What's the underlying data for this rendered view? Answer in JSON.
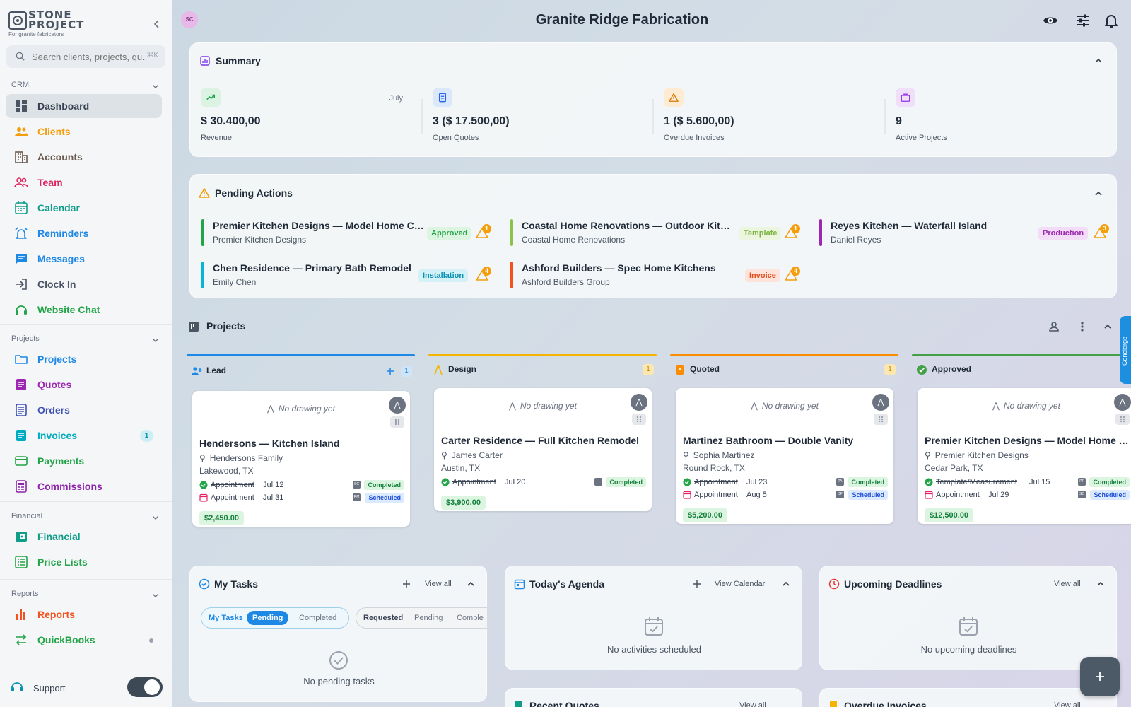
{
  "brand": {
    "line1": "STONE",
    "line2": "PROJECT",
    "tagline": "For granite fabricators"
  },
  "search": {
    "placeholder": "Search clients, projects, qu…",
    "shortcut": "⌘K"
  },
  "sidebar": {
    "sections": [
      {
        "label": "CRM",
        "items": [
          {
            "label": "Dashboard",
            "icon": "dashboard-icon",
            "color": "#4b5563",
            "active": true
          },
          {
            "label": "Clients",
            "icon": "people-icon",
            "color": "#f59e0b"
          },
          {
            "label": "Accounts",
            "icon": "building-icon",
            "color": "#6b5a4e"
          },
          {
            "label": "Team",
            "icon": "team-icon",
            "color": "#e0245e"
          },
          {
            "label": "Calendar",
            "icon": "calendar-icon",
            "color": "#0f9d8a"
          },
          {
            "label": "Reminders",
            "icon": "alarm-icon",
            "color": "#1e88e5"
          },
          {
            "label": "Messages",
            "icon": "message-icon",
            "color": "#1e88e5"
          },
          {
            "label": "Clock In",
            "icon": "login-icon",
            "color": "#4b5563"
          },
          {
            "label": "Website Chat",
            "icon": "headset-icon",
            "color": "#22a447"
          }
        ]
      },
      {
        "label": "Projects",
        "items": [
          {
            "label": "Projects",
            "icon": "folder-icon",
            "color": "#1e88e5"
          },
          {
            "label": "Quotes",
            "icon": "quote-icon",
            "color": "#9c27b0"
          },
          {
            "label": "Orders",
            "icon": "orders-icon",
            "color": "#3f51b5"
          },
          {
            "label": "Invoices",
            "icon": "invoice-icon",
            "color": "#00acc1",
            "badge": "1"
          },
          {
            "label": "Payments",
            "icon": "card-icon",
            "color": "#22a447"
          },
          {
            "label": "Commissions",
            "icon": "commission-icon",
            "color": "#8e24aa"
          }
        ]
      },
      {
        "label": "Financial",
        "items": [
          {
            "label": "Financial",
            "icon": "financial-icon",
            "color": "#0f9d8a"
          },
          {
            "label": "Price Lists",
            "icon": "pricelist-icon",
            "color": "#22a447"
          }
        ]
      },
      {
        "label": "Reports",
        "items": [
          {
            "label": "Reports",
            "icon": "barchart-icon",
            "color": "#f4511e"
          },
          {
            "label": "QuickBooks",
            "icon": "sync-icon",
            "color": "#22a447",
            "dot": true
          }
        ]
      }
    ],
    "support_label": "Support"
  },
  "header": {
    "avatar": "SC",
    "title": "Granite Ridge Fabrication"
  },
  "summary": {
    "title": "Summary",
    "metrics": [
      {
        "value": "$ 30.400,00",
        "label": "Revenue",
        "meta": "July",
        "icon": "trending-up-icon",
        "color": "#16a34a",
        "bg": "#dcf2e2"
      },
      {
        "value": "3 ($ 17.500,00)",
        "label": "Open Quotes",
        "meta": "",
        "icon": "document-icon",
        "color": "#2563eb",
        "bg": "#dbe8fb"
      },
      {
        "value": "1 ($ 5.600,00)",
        "label": "Overdue Invoices",
        "meta": "",
        "icon": "warning-icon",
        "color": "#d97706",
        "bg": "#fdecd3"
      },
      {
        "value": "9",
        "label": "Active Projects",
        "meta": "",
        "icon": "briefcase-icon",
        "color": "#9333ea",
        "bg": "#efdff9"
      }
    ]
  },
  "pending": {
    "title": "Pending Actions",
    "items": [
      {
        "title": "Premier Kitchen Designs — Model Home Co…",
        "sub": "Premier Kitchen Designs",
        "tag": "Approved",
        "tag_color": "#22a447",
        "tag_bg": "#dcf5e0",
        "bar": "#22a447",
        "count": "1"
      },
      {
        "title": "Coastal Home Renovations — Outdoor Kitc…",
        "sub": "Coastal Home Renovations",
        "tag": "Template",
        "tag_color": "#7cb342",
        "tag_bg": "#ecf5dd",
        "bar": "#8bc34a",
        "count": "1"
      },
      {
        "title": "Reyes Kitchen — Waterfall Island",
        "sub": "Daniel Reyes",
        "tag": "Production",
        "tag_color": "#9c27b0",
        "tag_bg": "#f3dcf7",
        "bar": "#9c27b0",
        "count": "3"
      },
      {
        "title": "Chen Residence — Primary Bath Remodel",
        "sub": "Emily Chen",
        "tag": "Installation",
        "tag_color": "#0891b2",
        "tag_bg": "#d4f1f7",
        "bar": "#06b6d4",
        "count": "4"
      },
      {
        "title": "Ashford Builders — Spec Home Kitchens",
        "sub": "Ashford Builders Group",
        "tag": "Invoice",
        "tag_color": "#e64a19",
        "tag_bg": "#fde3da",
        "bar": "#f4511e",
        "count": "4"
      }
    ]
  },
  "projects": {
    "title": "Projects",
    "columns": [
      {
        "label": "Lead",
        "count": "1",
        "color": "#1e88e5",
        "icon": "person-add-icon"
      },
      {
        "label": "Design",
        "count": "1",
        "color": "#f5b400",
        "icon": "compass-icon"
      },
      {
        "label": "Quoted",
        "count": "1",
        "color": "#fb8c00",
        "icon": "quote-doc-icon"
      },
      {
        "label": "Approved",
        "count": "",
        "color": "#43a047",
        "icon": "check-circle-icon"
      }
    ],
    "cards": [
      {
        "no_drawing": "No drawing yet",
        "title": "Hendersons — Kitchen Island",
        "person": "Hendersons Family",
        "location": "Lakewood, TX",
        "amount": "$2,450.00",
        "rows": [
          {
            "name": "Appointment",
            "date": "Jul 12",
            "status": "Completed",
            "initials": "SC",
            "done": true
          },
          {
            "name": "Appointment",
            "date": "Jul 31",
            "status": "Scheduled",
            "initials": "RM",
            "done": false
          }
        ]
      },
      {
        "no_drawing": "No drawing yet",
        "title": "Carter Residence — Full Kitchen Remodel",
        "person": "James Carter",
        "location": "Austin, TX",
        "amount": "$3,900.00",
        "rows": [
          {
            "name": "Appointment",
            "date": "Jul 20",
            "status": "Completed",
            "initials": "",
            "done": true
          }
        ]
      },
      {
        "no_drawing": "No drawing yet",
        "title": "Martinez Bathroom — Double Vanity",
        "person": "Sophia Martinez",
        "location": "Round Rock, TX",
        "amount": "$5,200.00",
        "rows": [
          {
            "name": "Appointment",
            "date": "Jul 23",
            "status": "Completed",
            "initials": "TA",
            "done": true
          },
          {
            "name": "Appointment",
            "date": "Aug 5",
            "status": "Scheduled",
            "initials": "DP",
            "done": false
          }
        ]
      },
      {
        "no_drawing": "No drawing yet",
        "title": "Premier Kitchen Designs — Model Home C…",
        "person": "Premier Kitchen Designs",
        "location": "Cedar Park, TX",
        "amount": "$12,500.00",
        "rows": [
          {
            "name": "Template/Measurement",
            "date": "Jul 15",
            "status": "Completed",
            "initials": "PF",
            "done": true
          },
          {
            "name": "Appointment",
            "date": "Jul 29",
            "status": "Scheduled",
            "initials": "SC",
            "done": false
          }
        ]
      }
    ]
  },
  "tasks": {
    "title": "My Tasks",
    "view_all": "View all",
    "tabs1": [
      "My Tasks",
      "Pending",
      "Completed"
    ],
    "tabs2": [
      "Requested",
      "Pending",
      "Comple"
    ],
    "empty": "No pending tasks"
  },
  "agenda": {
    "title": "Today's Agenda",
    "view": "View Calendar",
    "empty": "No activities scheduled"
  },
  "deadlines": {
    "title": "Upcoming Deadlines",
    "view_all": "View all",
    "empty": "No upcoming deadlines"
  },
  "bottom": {
    "recent_quotes": "Recent Quotes",
    "overdue_invoices": "Overdue Invoices",
    "view_all": "View all"
  },
  "side_tab": "Concierge"
}
